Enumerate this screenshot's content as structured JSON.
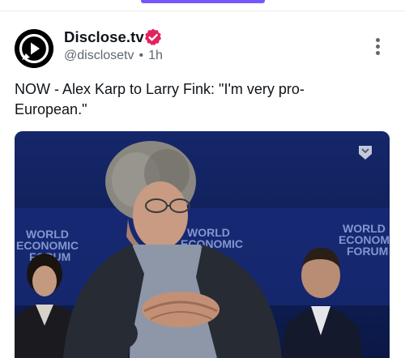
{
  "post": {
    "author_name": "Disclose.tv",
    "handle": "@disclosetv",
    "time": "1h",
    "separator": "•",
    "text": "NOW - Alex Karp to Larry Fink: \"I'm very pro-European.\""
  },
  "media": {
    "backdrop_words": [
      "WORLD",
      "ECONOMIC",
      "FORUM"
    ],
    "colors": {
      "stage": "#16286e",
      "backdrop": "#1b2f82"
    }
  },
  "colors": {
    "accent": "#7856ff",
    "verified": "#e0245e",
    "meta": "#5f6770"
  },
  "icons": [
    "disclose-logo-icon",
    "verified-badge-icon",
    "more-options-icon",
    "media-badge-icon"
  ]
}
